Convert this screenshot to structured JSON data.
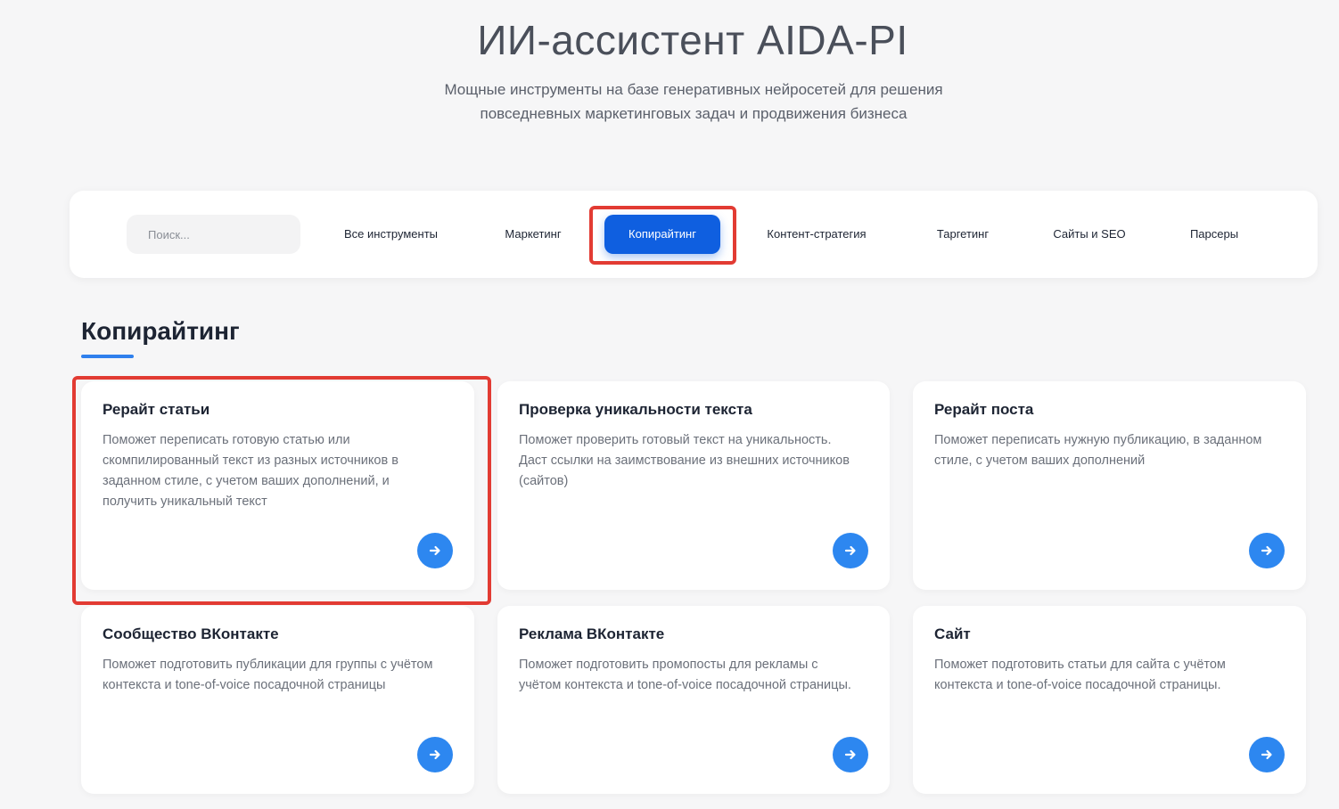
{
  "hero": {
    "title": "ИИ-ассистент AIDA-PI",
    "subtitle": "Мощные инструменты на базе генеративных нейросетей для решения повседневных маркетинговых задач и продвижения бизнеса"
  },
  "filters": {
    "search_placeholder": "Поиск...",
    "tabs": [
      {
        "label": "Все инструменты",
        "active": false
      },
      {
        "label": "Маркетинг",
        "active": false
      },
      {
        "label": "Копирайтинг",
        "active": true
      },
      {
        "label": "Контент-стратегия",
        "active": false
      },
      {
        "label": "Таргетинг",
        "active": false
      },
      {
        "label": "Сайты и SEO",
        "active": false
      },
      {
        "label": "Парсеры",
        "active": false
      }
    ]
  },
  "section": {
    "title": "Копирайтинг"
  },
  "cards": [
    {
      "title": "Рерайт статьи",
      "description": "Поможет переписать готовую статью или скомпилированный текст из разных источников в заданном стиле, с учетом ваших дополнений, и получить уникальный текст"
    },
    {
      "title": "Проверка уникальности текста",
      "description": "Поможет проверить готовый текст на уникальность. Даст ссылки на заимствование из внешних источников (сайтов)"
    },
    {
      "title": "Рерайт поста",
      "description": "Поможет переписать нужную публикацию, в заданном стиле, с учетом ваших дополнений"
    },
    {
      "title": "Сообщество ВКонтакте",
      "description": "Поможет подготовить публикации для группы с учётом контекста и tone-of-voice посадочной страницы"
    },
    {
      "title": "Реклама ВКонтакте",
      "description": "Поможет подготовить промопосты для рекламы с учётом контекста и tone-of-voice посадочной страницы."
    },
    {
      "title": "Сайт",
      "description": "Поможет подготовить статьи для сайта с учётом контекста и tone-of-voice посадочной страницы."
    }
  ],
  "colors": {
    "accent": "#0f5fe0",
    "button": "#2d87f0",
    "highlight": "#e23b33",
    "background": "#f6f6f7"
  }
}
